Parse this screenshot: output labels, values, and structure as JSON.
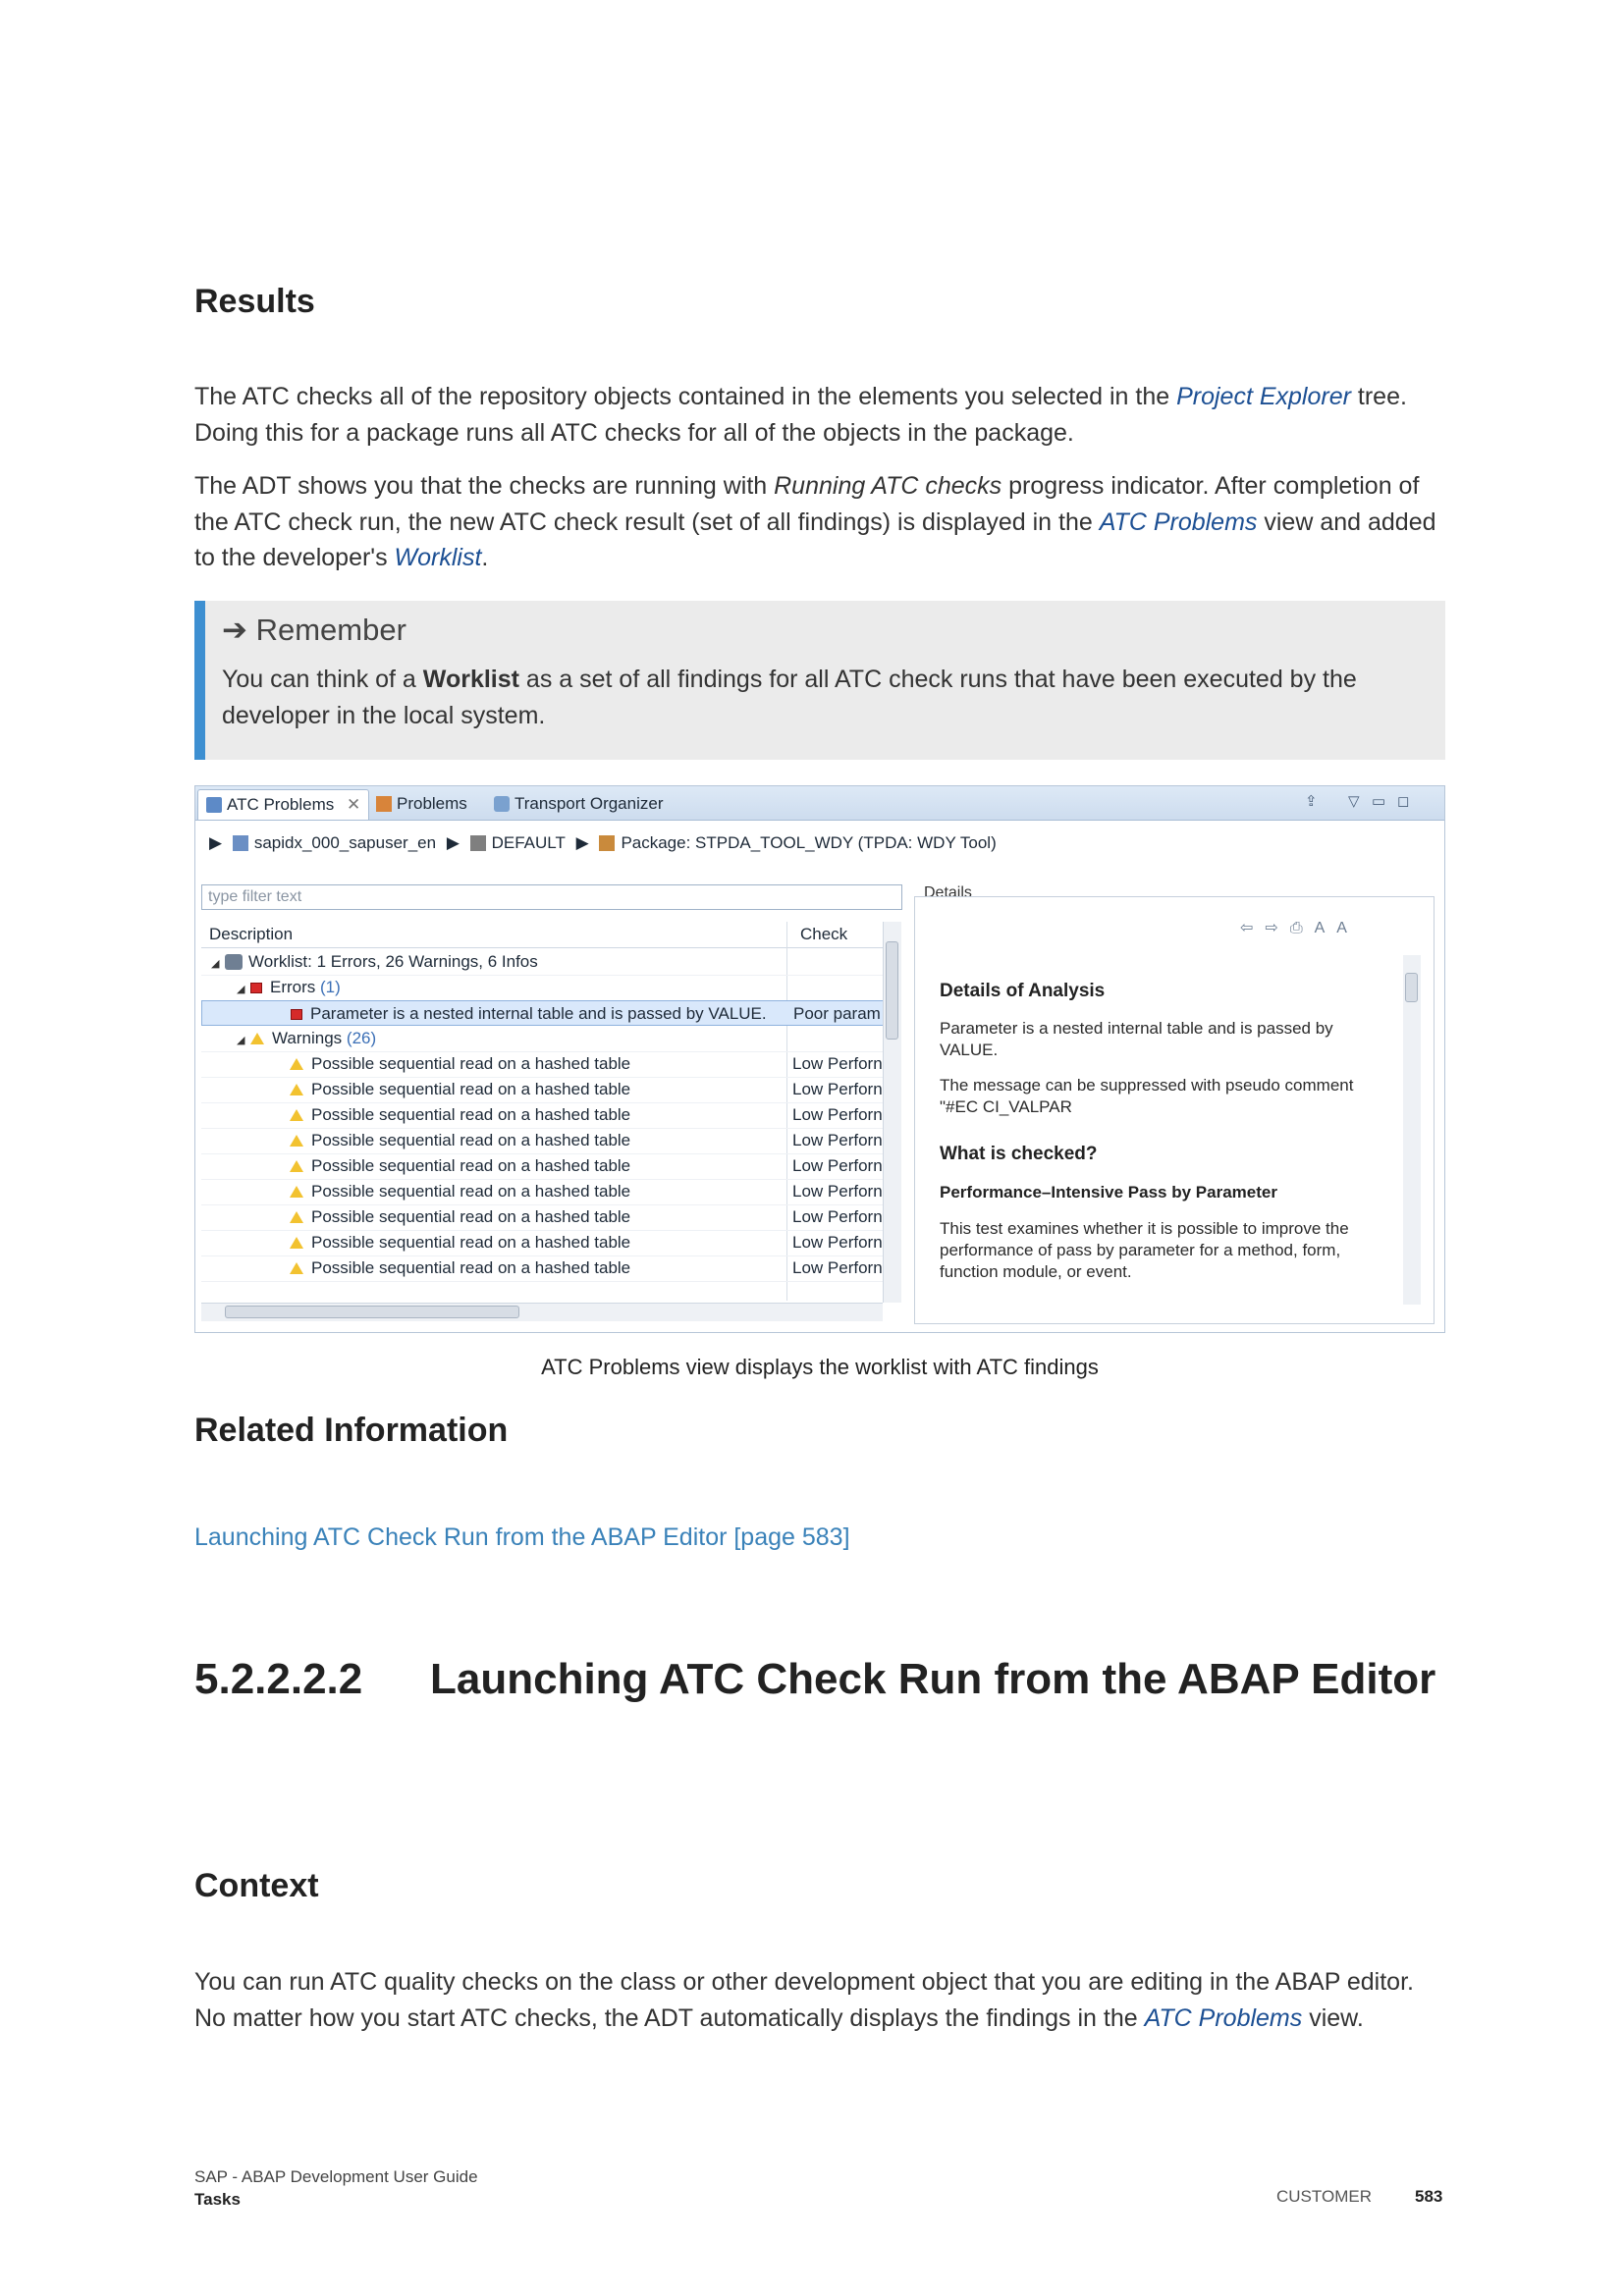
{
  "results": {
    "heading": "Results",
    "p1": {
      "before": "The ATC checks all of the repository objects contained in the elements you selected in the ",
      "link": "Project Explorer",
      "after": " tree. Doing this for a package runs all ATC checks for all of the objects in the package."
    },
    "p2": {
      "a": "The ADT shows you that the checks are running with ",
      "italic": "Running ATC checks",
      "b": " progress indicator. After completion of the ATC check run, the new ATC check result (set of all findings) is displayed in the ",
      "link1": "ATC Problems",
      "c": " view and added to the developer's ",
      "link2": "Worklist",
      "d": "."
    }
  },
  "remember": {
    "title": "Remember",
    "before": "You can think of a ",
    "bold": "Worklist",
    "after": " as a set of all findings for all ATC check runs that have been executed by the developer in the local system."
  },
  "screenshot": {
    "tabs": [
      "ATC Problems",
      "Problems",
      "Transport Organizer"
    ],
    "breadcrumb": [
      "sapidx_000_sapuser_en",
      "DEFAULT",
      "Package: STPDA_TOOL_WDY (TPDA: WDY Tool)"
    ],
    "filter_placeholder": "type filter text",
    "details_label": "Details",
    "columns": [
      "Description",
      "Check"
    ],
    "worklist": "Worklist: 1 Errors, 26 Warnings, 6 Infos",
    "errors_label": "Errors",
    "errors_count": "(1)",
    "selected_row": {
      "desc": "Parameter is a nested internal table and is passed by VALUE.",
      "check": "Poor param"
    },
    "warnings_label": "Warnings",
    "warnings_count": "(26)",
    "warning_rows": [
      {
        "desc": "Possible sequential read on a hashed table",
        "check": "Low Perforn"
      },
      {
        "desc": "Possible sequential read on a hashed table",
        "check": "Low Perforn"
      },
      {
        "desc": "Possible sequential read on a hashed table",
        "check": "Low Perforn"
      },
      {
        "desc": "Possible sequential read on a hashed table",
        "check": "Low Perforn"
      },
      {
        "desc": "Possible sequential read on a hashed table",
        "check": "Low Perforn"
      },
      {
        "desc": "Possible sequential read on a hashed table",
        "check": "Low Perforn"
      },
      {
        "desc": "Possible sequential read on a hashed table",
        "check": "Low Perforn"
      },
      {
        "desc": "Possible sequential read on a hashed table",
        "check": "Low Perforn"
      },
      {
        "desc": "Possible sequential read on a hashed table",
        "check": "Low Perforn"
      }
    ],
    "details": {
      "h1": "Details of Analysis",
      "t1": "Parameter is a nested internal table and is passed by VALUE.",
      "t2": "The message can be suppressed with pseudo comment \"#EC CI_VALPAR",
      "h2": "What is checked?",
      "sub": "Performance–Intensive Pass by Parameter",
      "t3": "This test examines whether it is possible to improve the performance of pass by parameter for a method, form, function module, or event."
    }
  },
  "caption": "ATC Problems view displays the worklist with ATC findings",
  "related": {
    "heading": "Related Information",
    "link": "Launching ATC Check Run from the ABAP Editor [page 583]"
  },
  "section": {
    "number": "5.2.2.2.2",
    "title": "Launching ATC Check Run from the ABAP Editor"
  },
  "context": {
    "heading": "Context",
    "before": "You can run ATC quality checks on the class or other development object that you are editing in the ABAP editor. No matter how you start ATC checks, the ADT automatically displays the findings in the ",
    "link": "ATC Problems",
    "after": " view."
  },
  "footer": {
    "line1": "SAP - ABAP Development User Guide",
    "line2": "Tasks",
    "label": "CUSTOMER",
    "page": "583"
  }
}
